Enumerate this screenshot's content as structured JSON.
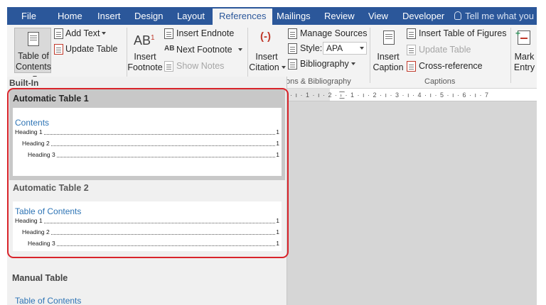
{
  "tabs": [
    {
      "label": "File",
      "active": false
    },
    {
      "label": "Home",
      "active": false
    },
    {
      "label": "Insert",
      "active": false
    },
    {
      "label": "Design",
      "active": false
    },
    {
      "label": "Layout",
      "active": false
    },
    {
      "label": "References",
      "active": true
    },
    {
      "label": "Mailings",
      "active": false
    },
    {
      "label": "Review",
      "active": false
    },
    {
      "label": "View",
      "active": false
    },
    {
      "label": "Developer",
      "active": false
    }
  ],
  "tell_me": "Tell me what you",
  "ribbon": {
    "toc": {
      "line1": "Table of",
      "line2": "Contents"
    },
    "add_text": "Add Text",
    "update_table": "Update Table",
    "footnote": {
      "big_text": "AB",
      "sup": "1",
      "line1": "Insert",
      "line2": "Footnote"
    },
    "insert_endnote": "Insert Endnote",
    "next_footnote": "Next Footnote",
    "show_notes": "Show Notes",
    "citation": {
      "line1": "Insert",
      "line2": "Citation"
    },
    "manage_sources": "Manage Sources",
    "style_label": "Style:",
    "style_value": "APA",
    "bibliography": "Bibliography",
    "citations_group_label": "ons & Bibliography",
    "caption": {
      "line1": "Insert",
      "line2": "Caption"
    },
    "insert_table_of_figures": "Insert Table of Figures",
    "update_table_2": "Update Table",
    "cross_reference": "Cross-reference",
    "captions_group_label": "Captions",
    "mark_entry": {
      "line1": "Mark",
      "line2": "Entry"
    }
  },
  "gallery": {
    "builtin_label": "Built-In",
    "auto1": {
      "title": "Automatic Table 1",
      "heading": "Contents",
      "entries": [
        {
          "label": "Heading 1",
          "page": "1"
        },
        {
          "label": "Heading 2",
          "page": "1"
        },
        {
          "label": "Heading 3",
          "page": "1"
        }
      ]
    },
    "auto2": {
      "title": "Automatic Table 2",
      "heading": "Table of Contents",
      "entries": [
        {
          "label": "Heading 1",
          "page": "1"
        },
        {
          "label": "Heading 2",
          "page": "1"
        },
        {
          "label": "Heading 3",
          "page": "1"
        }
      ]
    },
    "manual_title": "Manual Table",
    "manual_heading": "Table of Contents"
  },
  "ruler_text": "· ı · 1 · ı · 2 · ı · 1 · ı · 2 · ı · 3 · ı · 4 · ı · 5 · ı · 6 · ı · 7",
  "colors": {
    "tab_bar": "#2b579a",
    "highlight_border": "#d9242b",
    "toc_heading": "#2e74b5"
  }
}
